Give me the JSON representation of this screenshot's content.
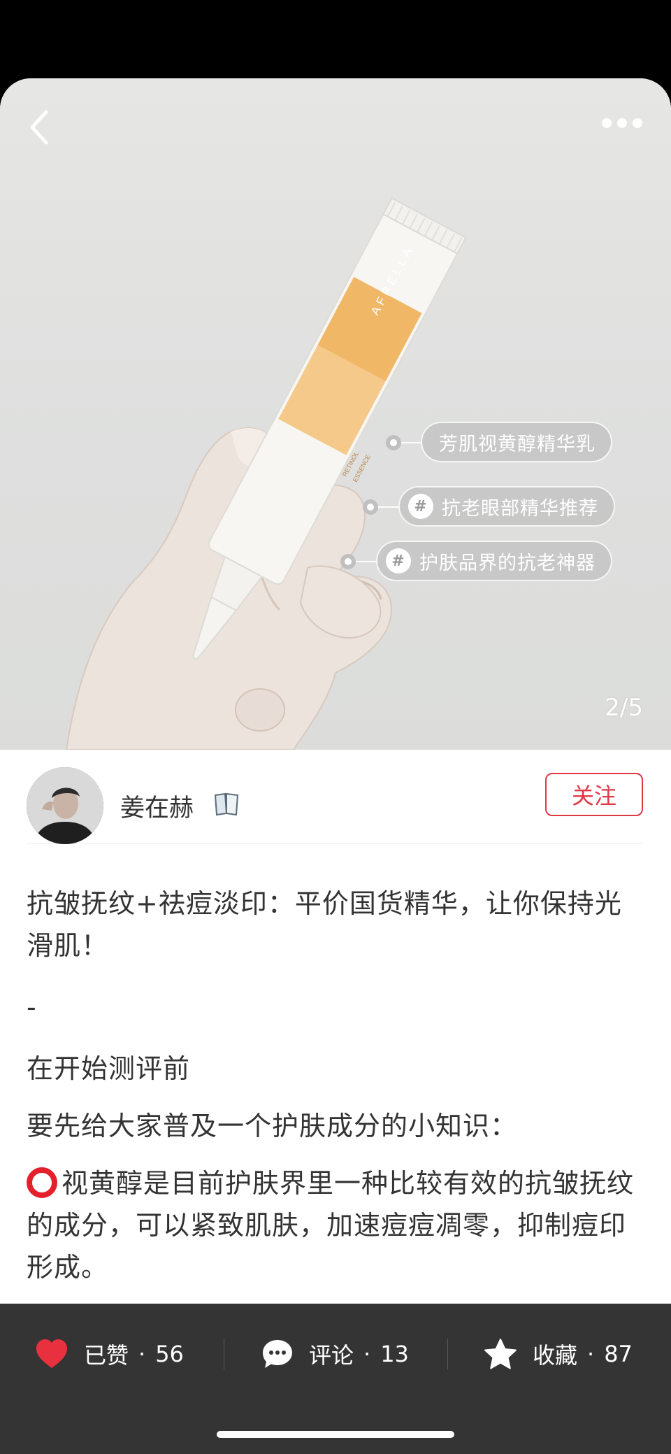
{
  "photo": {
    "pager": "2/5",
    "product_brand": "AFRELLA",
    "product_label_line1": "RETINOL",
    "product_label_line2": "ESSENCE",
    "tags": [
      {
        "text": "芳肌视黄醇精华乳",
        "icon": "none"
      },
      {
        "text": "抗老眼部精华推荐",
        "icon": "hash-icon"
      },
      {
        "text": "护肤品界的抗老神器",
        "icon": "hash-icon"
      }
    ]
  },
  "author": {
    "name": "姜在赫",
    "badge_icon": "book-icon",
    "follow_label": "关注"
  },
  "post": {
    "title": "抗皱抚纹+祛痘淡印：平价国货精华，让你保持光滑肌！",
    "separator": "-",
    "line1": "在开始测评前",
    "line2": "要先给大家普及一个护肤成分的小知识：",
    "line3": "视黄醇是目前护肤界里一种比较有效的抗皱抚纹的成分，可以紧致肌肤，加速痘痘凋零，抑制痘印形成。"
  },
  "actions": {
    "like": {
      "label": "已赞",
      "count": "56",
      "icon": "heart-icon",
      "color": "#e8303f"
    },
    "comment": {
      "label": "评论",
      "count": "13",
      "icon": "comment-icon"
    },
    "collect": {
      "label": "收藏",
      "count": "87",
      "icon": "star-icon"
    },
    "dot": "·"
  },
  "colors": {
    "accent": "#e03845",
    "bottom_bar": "#343434"
  }
}
